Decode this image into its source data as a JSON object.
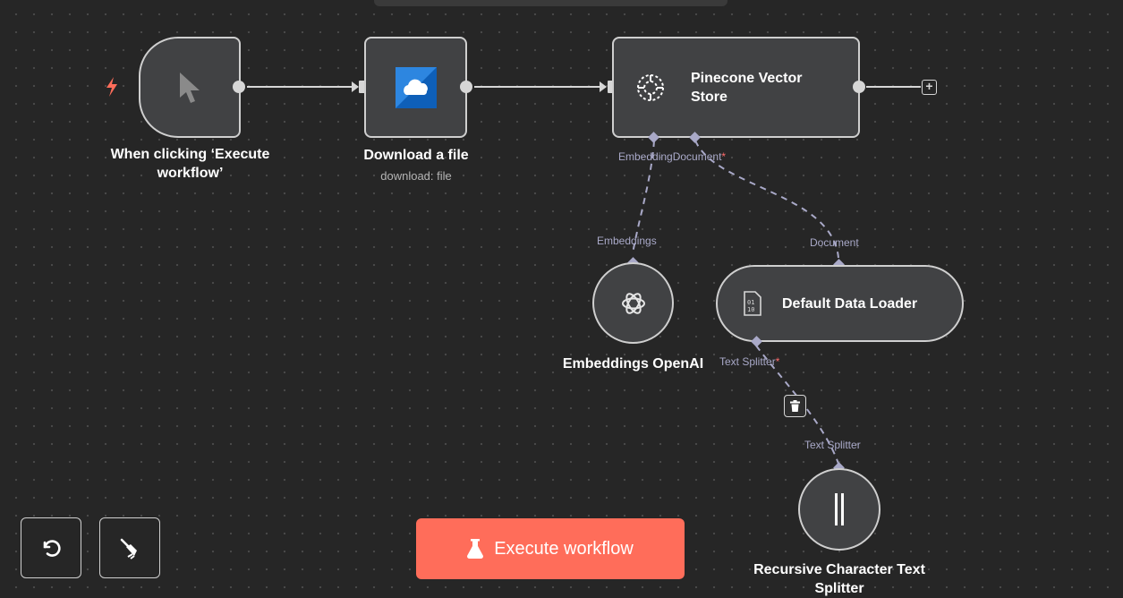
{
  "nodes": {
    "trigger": {
      "title": "When clicking ‘Execute workflow’",
      "icon": "cursor-icon"
    },
    "download": {
      "title": "Download a file",
      "subtitle": "download: file",
      "icon": "onedrive-icon"
    },
    "pinecone": {
      "title": "Pinecone Vector Store",
      "icon": "pinecone-icon"
    },
    "embeddings": {
      "title": "Embeddings OpenAI",
      "icon": "openai-icon"
    },
    "loader": {
      "title": "Default Data Loader",
      "icon": "binary-file-icon"
    },
    "splitter": {
      "title": "Recursive Character Text Splitter",
      "icon": "text-splitter-icon"
    }
  },
  "ports": {
    "pinecone_embedding": "Embedding",
    "pinecone_document": "Document",
    "embeddings_out": "Embeddings",
    "loader_out": "Document",
    "loader_text_splitter": "Text Splitter",
    "splitter_out": "Text Splitter",
    "required_marker": "*"
  },
  "toolbar": {
    "execute_label": "Execute workflow",
    "undo_icon": "undo-icon",
    "clean_icon": "broom-icon"
  },
  "colors": {
    "canvas": "#262626",
    "node_bg": "#414244",
    "accent": "#ff6d5a",
    "port": "#a9a9c8"
  }
}
